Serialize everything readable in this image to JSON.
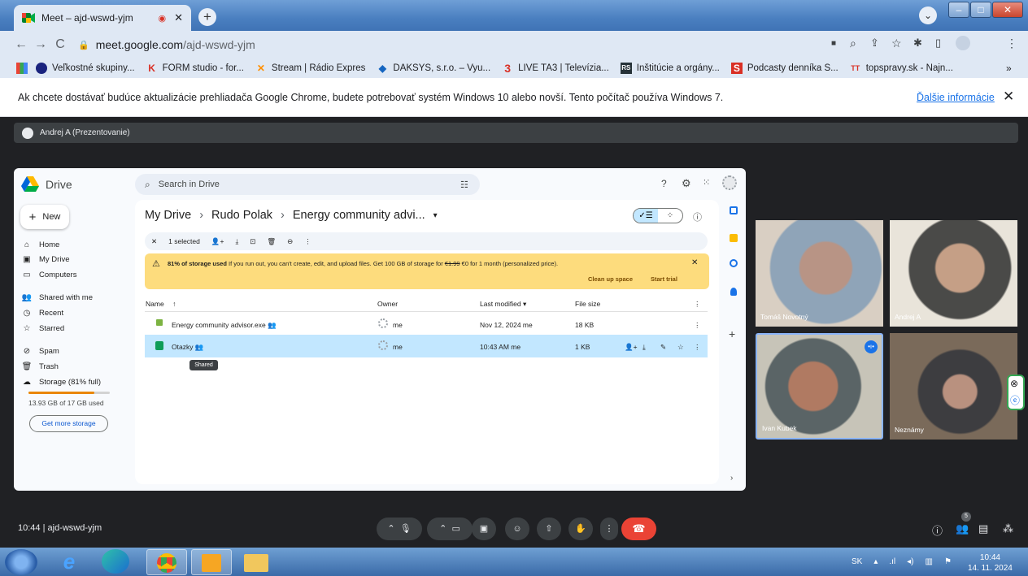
{
  "browser": {
    "tab_title": "Meet – ajd-wswd-yjm",
    "url_host": "meet.google.com",
    "url_path": "/ajd-wswd-yjm",
    "bookmarks": [
      "Veľkostné skupiny...",
      "FORM studio - for...",
      "Stream | Rádio Expres",
      "DAKSYS, s.r.o. – Vyu...",
      "LIVE TA3 | Televízia...",
      "Inštitúcie a orgány...",
      "Podcasty denníka S...",
      "topspravy.sk - Najn..."
    ],
    "bookmark_icons": [
      "K",
      "✕",
      "◆",
      "3",
      "RS",
      "S",
      "TT"
    ],
    "bookmarks_more": "»",
    "info_message": "Ak chcete dostávať budúce aktualizácie prehliadača Google Chrome, budete potrebovať systém Windows 10 alebo novší. Tento počítač používa Windows 7.",
    "info_link": "Ďalšie informácie",
    "info_close": "✕"
  },
  "meet": {
    "presenter_label": "Andrej A (Prezentovanie)",
    "meeting_time": "10:44",
    "meeting_code": "ajd-wswd-yjm",
    "participants_count": "5",
    "participants": [
      {
        "name": "Tomáš Novotný"
      },
      {
        "name": "Andrej A"
      },
      {
        "name": "Ivan Kubek"
      },
      {
        "name": "Neznámy"
      }
    ]
  },
  "drive": {
    "app_name": "Drive",
    "search_placeholder": "Search in Drive",
    "new_label": "New",
    "nav": [
      "Home",
      "My Drive",
      "Computers",
      "Shared with me",
      "Recent",
      "Starred",
      "Spam",
      "Trash",
      "Storage (81% full)"
    ],
    "storage_fraction": 0.81,
    "storage_used": "13.93 GB of 17 GB used",
    "get_more": "Get more storage",
    "breadcrumb": [
      "My Drive",
      "Rudo Polak",
      "Energy community advi..."
    ],
    "breadcrumb_sep": "›",
    "breadcrumb_caret": "▾",
    "selected_label": "1 selected",
    "warning_bold": "81% of storage used",
    "warning_text": " If you run out, you can't create, edit, and upload files. Get 100 GB of storage for ",
    "warning_old_price": "€1.99",
    "warning_new_price": " €0 for 1 month (personalized price).",
    "cleanup": "Clean up space",
    "start_trial": "Start trial",
    "columns": {
      "name": "Name",
      "owner": "Owner",
      "modified": "Last modified",
      "size": "File size"
    },
    "files": [
      {
        "name": "Energy community advisor.exe",
        "owner": "me",
        "modified": "Nov 12, 2024 me",
        "size": "18 KB"
      },
      {
        "name": "Otazky",
        "owner": "me",
        "modified": "10:43 AM me",
        "size": "1 KB"
      }
    ],
    "tooltip": "Shared"
  },
  "taskbar": {
    "lang": "SK",
    "time": "10:44",
    "date": "14. 11. 2024"
  },
  "colors": {
    "accent": "#1a73e8",
    "end_call": "#ea4335",
    "warning": "#fddc7d",
    "selected_row": "#c2e7ff"
  }
}
